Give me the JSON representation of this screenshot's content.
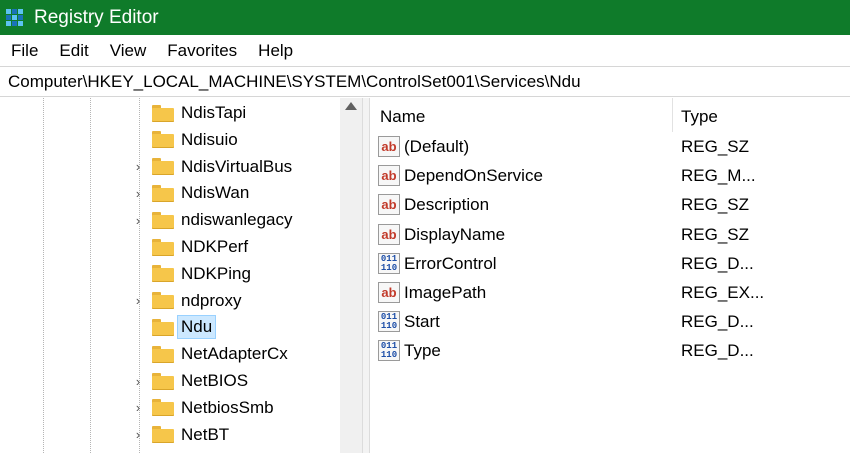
{
  "window": {
    "title": "Registry Editor"
  },
  "menu": [
    "File",
    "Edit",
    "View",
    "Favorites",
    "Help"
  ],
  "address": "Computer\\HKEY_LOCAL_MACHINE\\SYSTEM\\ControlSet001\\Services\\Ndu",
  "tree": {
    "items": [
      {
        "label": "NdisTapi",
        "expandable": false,
        "selected": false
      },
      {
        "label": "Ndisuio",
        "expandable": false,
        "selected": false
      },
      {
        "label": "NdisVirtualBus",
        "expandable": true,
        "selected": false
      },
      {
        "label": "NdisWan",
        "expandable": true,
        "selected": false
      },
      {
        "label": "ndiswanlegacy",
        "expandable": true,
        "selected": false
      },
      {
        "label": "NDKPerf",
        "expandable": false,
        "selected": false
      },
      {
        "label": "NDKPing",
        "expandable": false,
        "selected": false
      },
      {
        "label": "ndproxy",
        "expandable": true,
        "selected": false
      },
      {
        "label": "Ndu",
        "expandable": false,
        "selected": true
      },
      {
        "label": "NetAdapterCx",
        "expandable": false,
        "selected": false
      },
      {
        "label": "NetBIOS",
        "expandable": true,
        "selected": false
      },
      {
        "label": "NetbiosSmb",
        "expandable": true,
        "selected": false
      },
      {
        "label": "NetBT",
        "expandable": true,
        "selected": false
      }
    ]
  },
  "list": {
    "columns": {
      "name": "Name",
      "type": "Type"
    },
    "rows": [
      {
        "icon": "string-value-icon",
        "glyph": "ab",
        "name": "(Default)",
        "type": "REG_SZ"
      },
      {
        "icon": "string-value-icon",
        "glyph": "ab",
        "name": "DependOnService",
        "type": "REG_M..."
      },
      {
        "icon": "string-value-icon",
        "glyph": "ab",
        "name": "Description",
        "type": "REG_SZ"
      },
      {
        "icon": "string-value-icon",
        "glyph": "ab",
        "name": "DisplayName",
        "type": "REG_SZ"
      },
      {
        "icon": "binary-value-icon",
        "glyph": "011\n110",
        "name": "ErrorControl",
        "type": "REG_D..."
      },
      {
        "icon": "string-value-icon",
        "glyph": "ab",
        "name": "ImagePath",
        "type": "REG_EX..."
      },
      {
        "icon": "binary-value-icon",
        "glyph": "011\n110",
        "name": "Start",
        "type": "REG_D..."
      },
      {
        "icon": "binary-value-icon",
        "glyph": "011\n110",
        "name": "Type",
        "type": "REG_D..."
      }
    ]
  }
}
